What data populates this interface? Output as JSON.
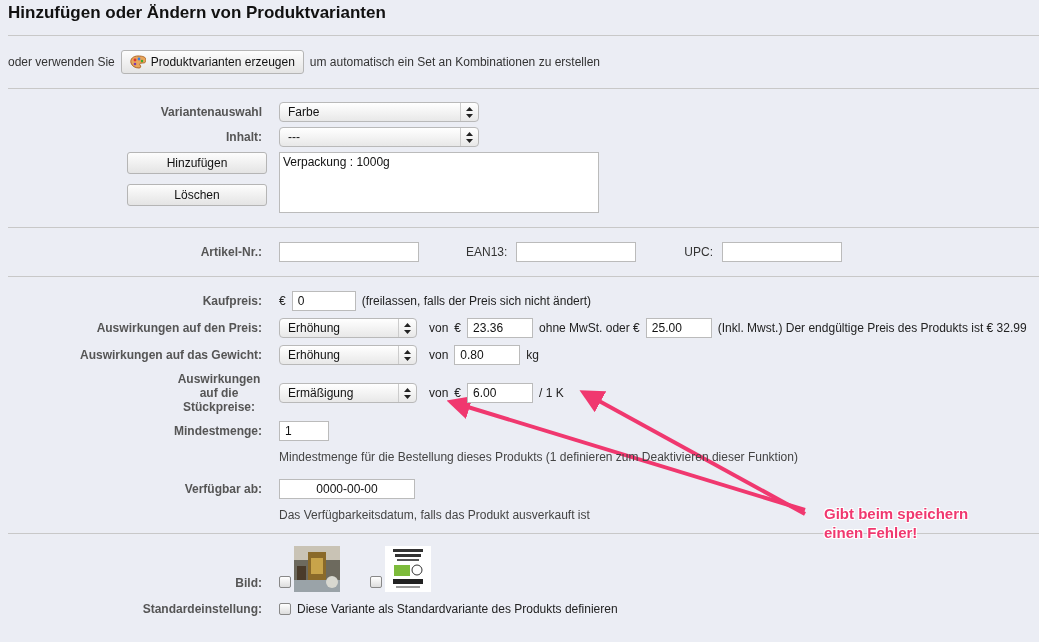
{
  "title": "Hinzufügen oder Ändern von Produktvarianten",
  "intro": {
    "before": "oder verwenden Sie",
    "button": "Produktvarianten erzeugen",
    "after": "um automatisch ein Set an Kombinationen zu erstellen"
  },
  "attributes": {
    "selects": [
      {
        "label": "Variantenauswahl",
        "value": "Farbe"
      },
      {
        "label": "Inhalt:",
        "value": "---"
      }
    ],
    "buttons": [
      "Hinzufügen",
      "Löschen"
    ],
    "combinations": [
      "Verpackung : 1000g"
    ]
  },
  "identifiers": [
    {
      "label": "Artikel-Nr.:"
    },
    {
      "label": "EAN13:"
    },
    {
      "label": "UPC:"
    }
  ],
  "pricing": [
    {
      "label": "Kaufpreis:",
      "parts": [
        {
          "kind": "text",
          "text": "€"
        },
        {
          "kind": "input",
          "value": "0"
        },
        {
          "kind": "text",
          "text": "(freilassen, falls der Preis sich nicht ändert)"
        }
      ]
    },
    {
      "label": "Auswirkungen auf den Preis:",
      "parts": [
        {
          "kind": "select",
          "value": "Erhöhung"
        },
        {
          "kind": "text",
          "text": "von"
        },
        {
          "kind": "text",
          "text": "€"
        },
        {
          "kind": "input",
          "value": "23.36"
        },
        {
          "kind": "text",
          "text": "ohne MwSt. oder €"
        },
        {
          "kind": "input",
          "value": "25.00"
        },
        {
          "kind": "text",
          "text": "(Inkl. Mwst.) Der endgültige Preis des Produkts ist € 32.99"
        }
      ]
    },
    {
      "label": "Auswirkungen auf das Gewicht:",
      "parts": [
        {
          "kind": "select",
          "value": "Erhöhung"
        },
        {
          "kind": "text",
          "text": "von"
        },
        {
          "kind": "input",
          "value": "0.80"
        },
        {
          "kind": "text",
          "text": "kg"
        }
      ]
    },
    {
      "label": "Auswirkungen auf die Stückpreise:",
      "parts": [
        {
          "kind": "select",
          "value": "Ermäßigung"
        },
        {
          "kind": "text",
          "text": "von"
        },
        {
          "kind": "text",
          "text": "€"
        },
        {
          "kind": "input",
          "value": "6.00"
        },
        {
          "kind": "text",
          "text": "/ 1 K"
        }
      ]
    },
    {
      "label": "Mindestmenge:",
      "parts": [
        {
          "kind": "input",
          "value": "1"
        }
      ],
      "help": "Mindestmenge für die Bestellung dieses Produkts (1 definieren zum Deaktivieren dieser Funktion)"
    },
    {
      "label": "Verfügbar ab:",
      "parts": [
        {
          "kind": "date",
          "value": "0000-00-00"
        }
      ],
      "help": "Das Verfügbarkeitsdatum, falls das Produkt ausverkauft ist"
    }
  ],
  "images": {
    "label": "Bild:",
    "items": [
      {
        "checked": false
      },
      {
        "checked": false
      }
    ]
  },
  "default": {
    "label": "Standardeinstellung:",
    "checked": false,
    "text": "Diese Variante als Standardvariante des Produkts definieren"
  },
  "annotation": {
    "text": "Gibt beim speichern\neinen Fehler!"
  }
}
